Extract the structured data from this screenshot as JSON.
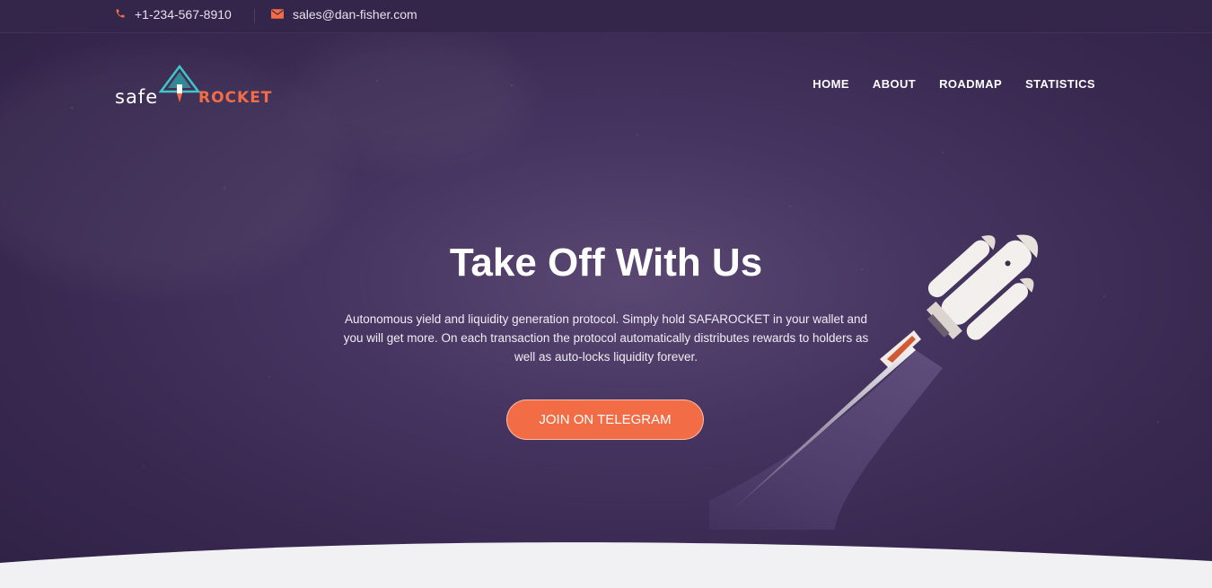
{
  "topbar": {
    "phone": "+1-234-567-8910",
    "email": "sales@dan-fisher.com"
  },
  "logo": {
    "word_left": "safe",
    "word_right": "ROCKET"
  },
  "nav": {
    "items": [
      {
        "label": "HOME"
      },
      {
        "label": "ABOUT"
      },
      {
        "label": "ROADMAP"
      },
      {
        "label": "STATISTICS"
      }
    ]
  },
  "hero": {
    "title": "Take Off With Us",
    "description": "Autonomous yield and liquidity generation protocol. Simply hold SAFAROCKET in your wallet and you will get more. On each transaction the protocol automatically distributes rewards to holders as well as auto-locks liquidity forever.",
    "cta_label": "JOIN ON TELEGRAM"
  },
  "colors": {
    "accent": "#f26d46",
    "background": "#3a2a52",
    "logo_teal": "#3ec6c9"
  },
  "icons": {
    "phone": "phone-icon",
    "email": "envelope-icon"
  }
}
